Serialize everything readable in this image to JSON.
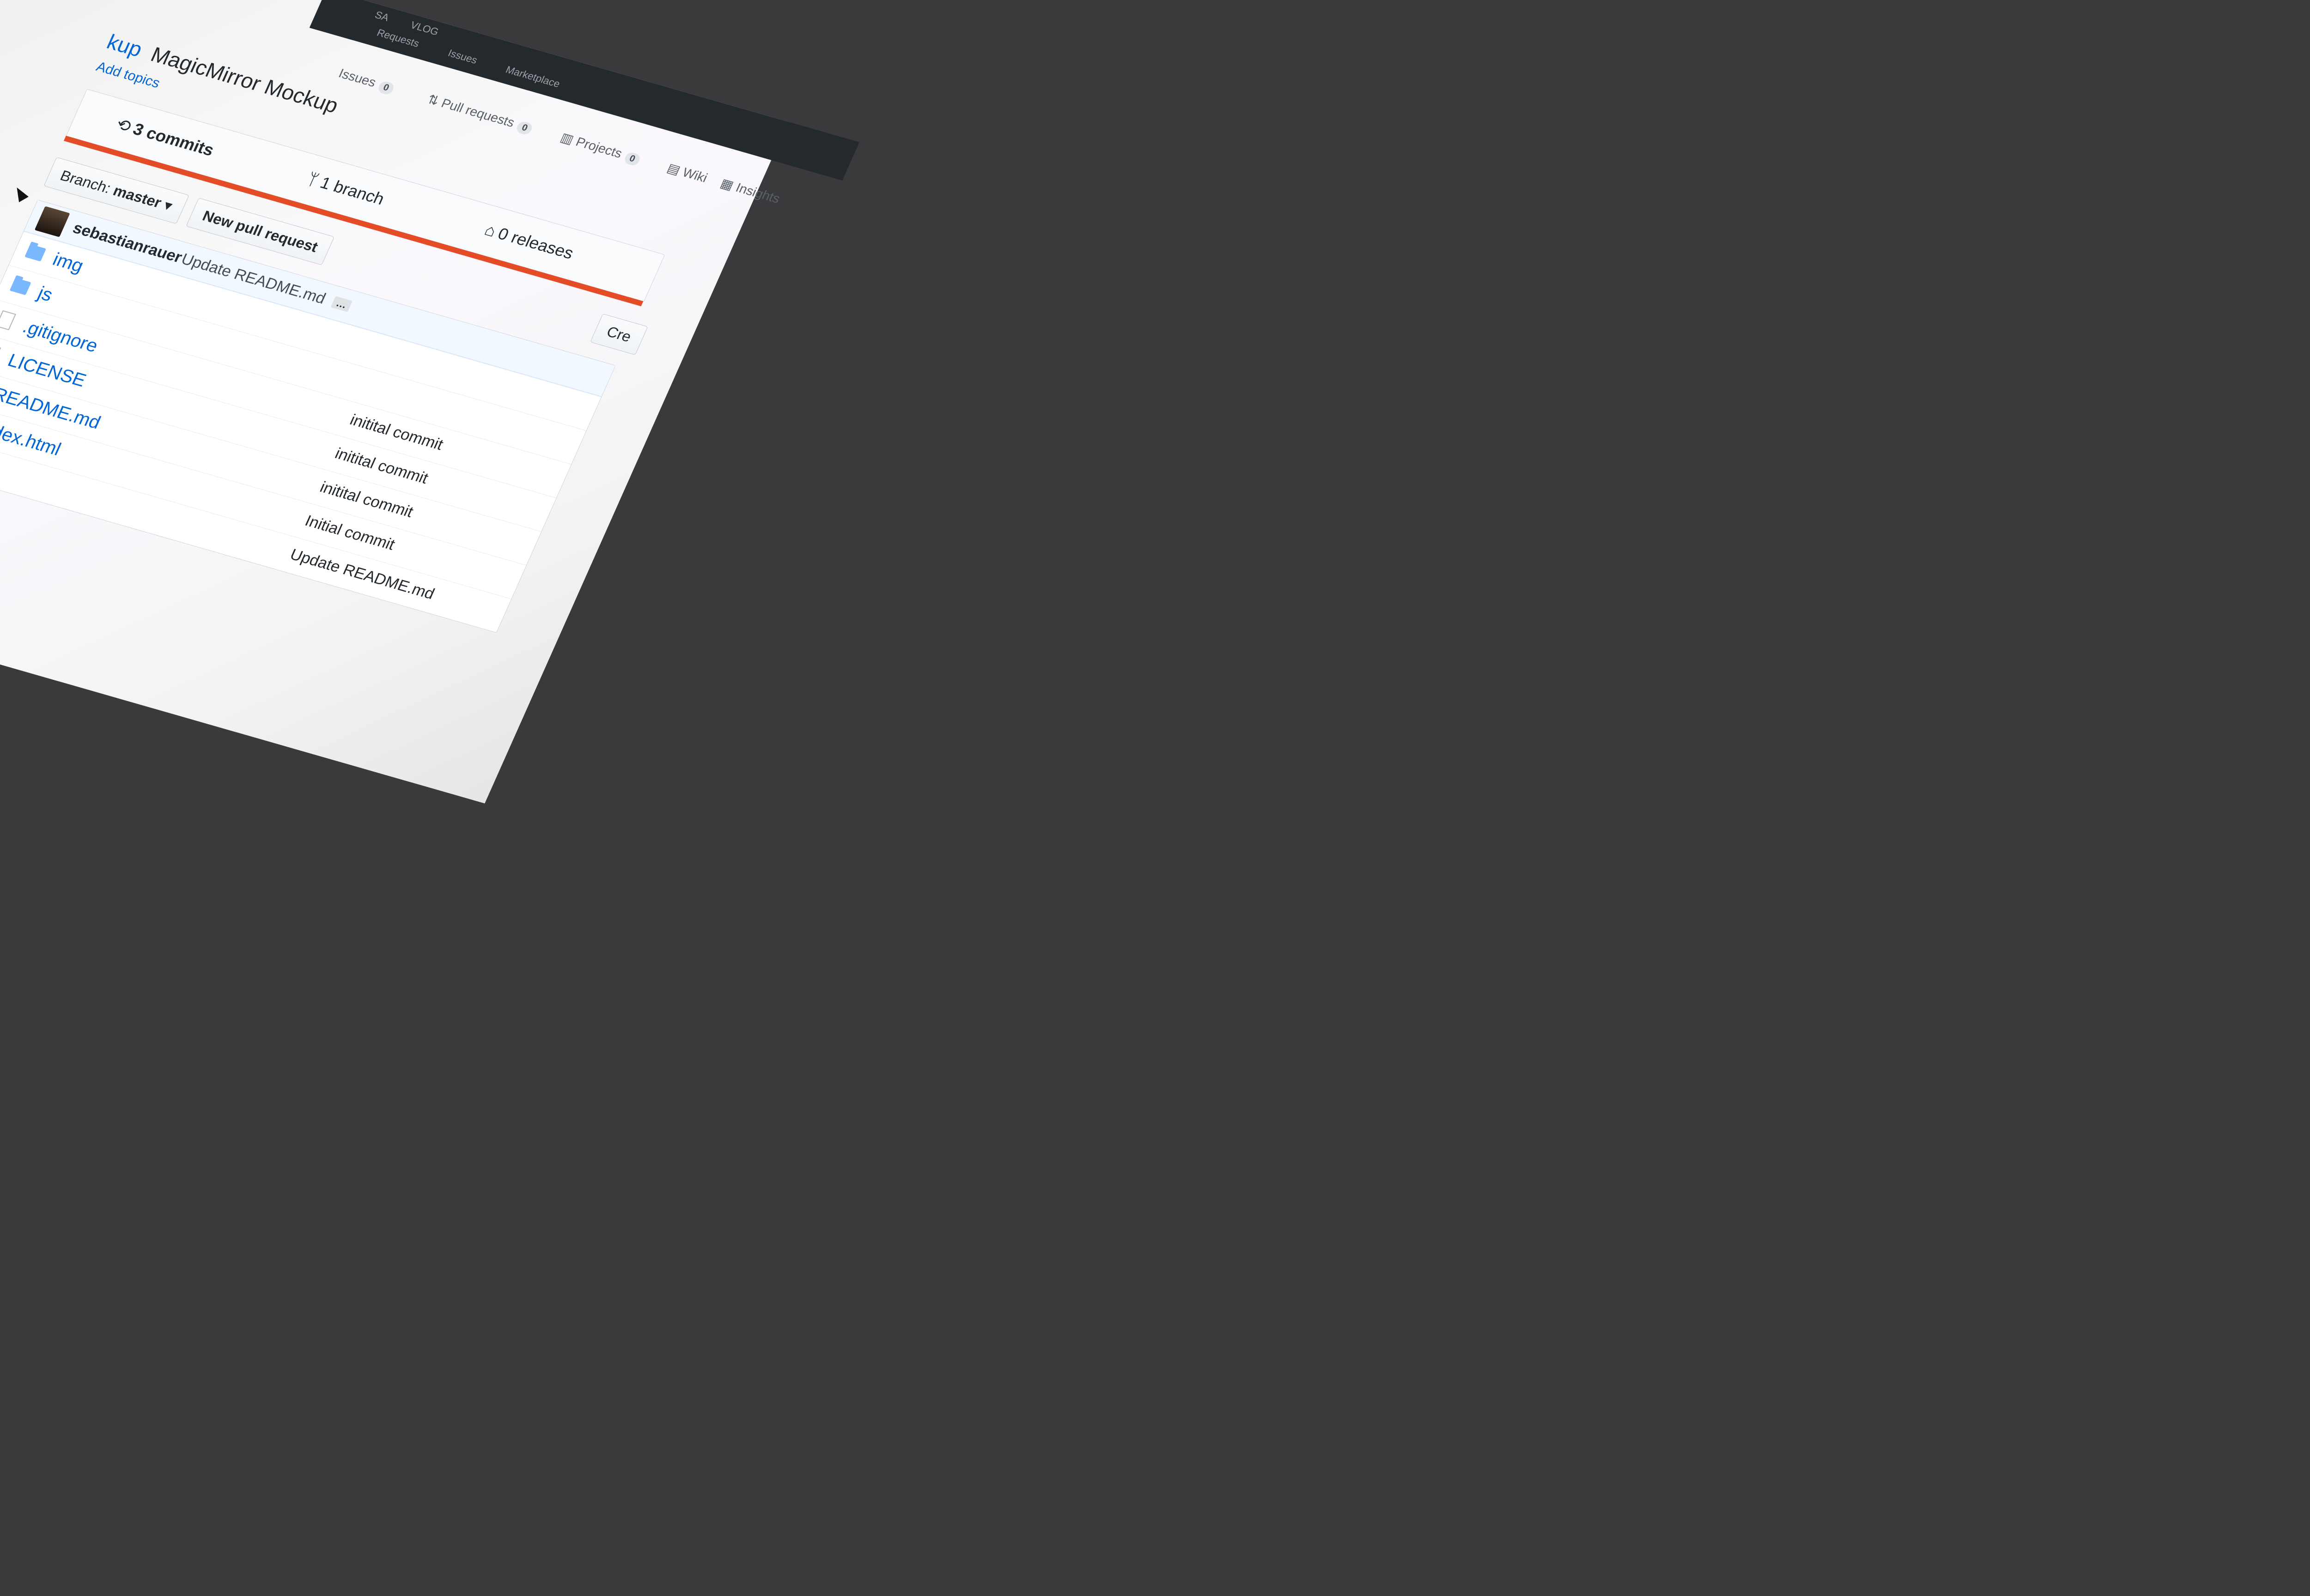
{
  "topnav": {
    "items": [
      "Requests",
      "Issues",
      "Marketplace"
    ],
    "right_items": [
      "SA",
      "VLOG"
    ]
  },
  "repo": {
    "owner_fragment": "kup",
    "title": "MagicMirror Mockup",
    "add_topics": "Add topics"
  },
  "tabs": [
    {
      "label": "Issues",
      "count": "0"
    },
    {
      "label": "Pull requests",
      "count": "0"
    },
    {
      "label": "Projects",
      "count": "0"
    },
    {
      "label": "Wiki",
      "count": ""
    },
    {
      "label": "Insights",
      "count": ""
    }
  ],
  "summary": {
    "commits": "3 commits",
    "branches": "1 branch",
    "releases": "0 releases"
  },
  "language_bar_color": "#e34c26",
  "toolbar": {
    "branch_prefix": "Branch:",
    "branch_name": "master",
    "new_pr": "New pull request",
    "create": "Cre"
  },
  "latest_commit": {
    "author": "sebastianrauer",
    "message": "Update README.md",
    "more": "…"
  },
  "files": [
    {
      "name": "img",
      "type": "dir",
      "message": ""
    },
    {
      "name": "js",
      "type": "dir",
      "message": ""
    },
    {
      "name": ".gitignore",
      "type": "file",
      "message": "initital commit"
    },
    {
      "name": "LICENSE",
      "type": "file",
      "message": "initital commit"
    },
    {
      "name": "README.md",
      "type": "file",
      "message": "initital commit"
    },
    {
      "name": "index.html",
      "type": "file",
      "message": "Initial commit"
    },
    {
      "name": "",
      "type": "file",
      "message": "Update README.md"
    }
  ]
}
